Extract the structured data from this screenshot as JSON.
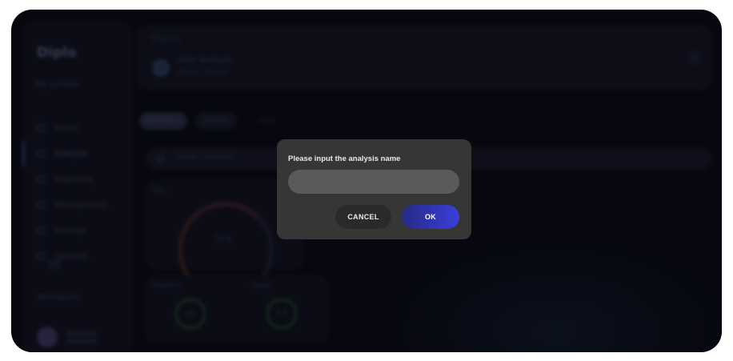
{
  "background_app": {
    "logo": "Diplo",
    "workspace": "My Lumina",
    "nav": {
      "items": [
        {
          "label": "Home"
        },
        {
          "label": "Analysis",
          "active": true
        },
        {
          "label": "Reporting"
        },
        {
          "label": "Management"
        },
        {
          "label": "Storage"
        },
        {
          "label": "Updates"
        }
      ]
    },
    "footer_workspace": "Workspace",
    "user": {},
    "header": {
      "breadcrumb": "Projects",
      "project_title": "Main Analysis",
      "project_subtitle": "Project details"
    },
    "tabs": [
      {
        "label": "Summary"
      },
      {
        "label": "Details"
      },
      {
        "label": "Logs"
      }
    ],
    "search_text": "Global Overview",
    "main_card": {
      "label": "Tab",
      "gauge_value": "71%"
    },
    "small_card": {
      "label_left": "Baseline",
      "label_right": "Speed",
      "ring_left": "80",
      "ring_right": "4.8"
    }
  },
  "dialog": {
    "title": "Please input the analysis name",
    "input": {
      "value": "",
      "placeholder": ""
    },
    "cancel_label": "CANCEL",
    "ok_label": "OK"
  },
  "colors": {
    "dialog_bg": "#363636",
    "input_bg": "#5a5a5a",
    "ok_gradient_start": "#262a86",
    "ok_gradient_end": "#3a3fd8",
    "cancel_bg": "#2a2a2a"
  }
}
